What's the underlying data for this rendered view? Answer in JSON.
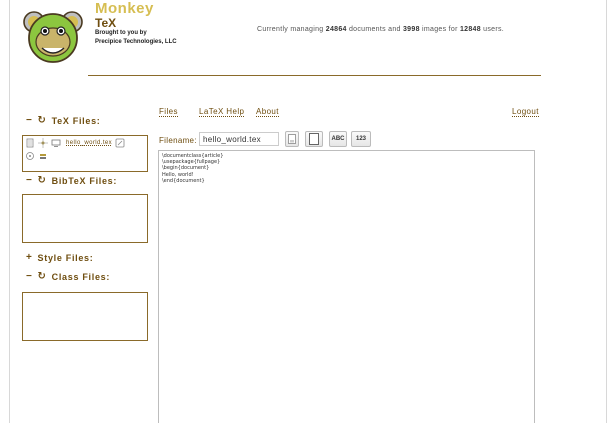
{
  "header": {
    "brand_title": "Monkey",
    "brand_sub": "TeX",
    "brought_by": "Brought to you by",
    "company": "Precipice Technologies, LLC",
    "stats": {
      "prefix": "Currently managing",
      "documents": "24864",
      "mid1": "documents and",
      "images": "3998",
      "mid2": "images for",
      "users": "12848",
      "suffix": "users."
    }
  },
  "nav": {
    "files": "Files",
    "latex_help": "LaTeX Help",
    "about": "About",
    "logout": "Logout"
  },
  "sidebar": {
    "tex_files": {
      "title": "TeX Files:",
      "collapse": "−",
      "refresh": "↻",
      "files": [
        "hello_world.tex"
      ]
    },
    "bibtex_files": {
      "title": "BibTeX Files:",
      "collapse": "−",
      "refresh": "↻"
    },
    "style_files": {
      "title": "Style Files:",
      "expand": "+"
    },
    "class_files": {
      "title": "Class Files:",
      "collapse": "−",
      "refresh": "↻"
    }
  },
  "toolbar": {
    "filename_label": "Filename:",
    "filename_value": "hello_world.tex",
    "spellcheck_label": "ABC",
    "numbers_label": "123"
  },
  "editor": {
    "lines": [
      "\\documentclass{article}",
      "\\usepackage{fullpage}",
      "\\begin{document}",
      "Hello, world!",
      "\\end{document}"
    ]
  }
}
